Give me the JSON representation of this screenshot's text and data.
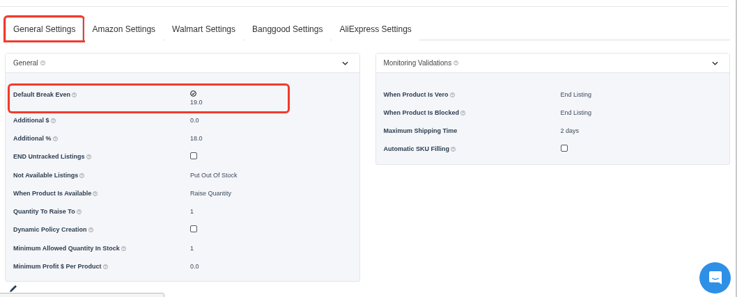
{
  "tabs": [
    {
      "label": "General Settings",
      "selected": true,
      "highlighted": true
    },
    {
      "label": "Amazon Settings",
      "selected": false,
      "highlighted": false
    },
    {
      "label": "Walmart Settings",
      "selected": false,
      "highlighted": false
    },
    {
      "label": "Banggood Settings",
      "selected": false,
      "highlighted": false
    },
    {
      "label": "AliExpress Settings",
      "selected": false,
      "highlighted": false
    }
  ],
  "panels": [
    {
      "title": "General",
      "expanded": true,
      "rows": [
        {
          "kind": "check-value",
          "label": "Default Break Even",
          "help": true,
          "highlighted": true,
          "checked": true,
          "value": "19.0"
        },
        {
          "kind": "text",
          "label": "Additional $",
          "help": true,
          "highlighted": false,
          "value": "0.0"
        },
        {
          "kind": "text",
          "label": "Additional %",
          "help": true,
          "highlighted": false,
          "value": "18.0"
        },
        {
          "kind": "checkbox",
          "label": "END Untracked Listings",
          "help": true,
          "highlighted": false,
          "checked": false
        },
        {
          "kind": "text",
          "label": "Not Available Listings",
          "help": true,
          "highlighted": false,
          "value": "Put Out Of Stock"
        },
        {
          "kind": "text",
          "label": "When Product Is Available",
          "help": true,
          "highlighted": false,
          "value": "Raise Quantity"
        },
        {
          "kind": "text",
          "label": "Quantity To Raise To",
          "help": true,
          "highlighted": false,
          "value": "1"
        },
        {
          "kind": "checkbox",
          "label": "Dynamic Policy Creation",
          "help": true,
          "highlighted": false,
          "checked": false
        },
        {
          "kind": "text",
          "label": "Minimum Allowed Quantity In Stock",
          "help": true,
          "highlighted": false,
          "value": "1"
        },
        {
          "kind": "text",
          "label": "Minimum Profit $ Per Product",
          "help": true,
          "highlighted": false,
          "value": "0.0"
        }
      ]
    },
    {
      "title": "Monitoring Validations",
      "expanded": true,
      "rows": [
        {
          "kind": "text",
          "label": "When Product Is Vero",
          "help": true,
          "highlighted": false,
          "value": "End Listing"
        },
        {
          "kind": "text",
          "label": "When Product Is Blocked",
          "help": true,
          "highlighted": false,
          "value": "End Listing"
        },
        {
          "kind": "text",
          "label": "Maximum Shipping Time",
          "help": false,
          "highlighted": false,
          "value": "2 days"
        },
        {
          "kind": "checkbox",
          "label": "Automatic SKU Filling",
          "help": true,
          "highlighted": false,
          "checked": false
        }
      ]
    }
  ]
}
